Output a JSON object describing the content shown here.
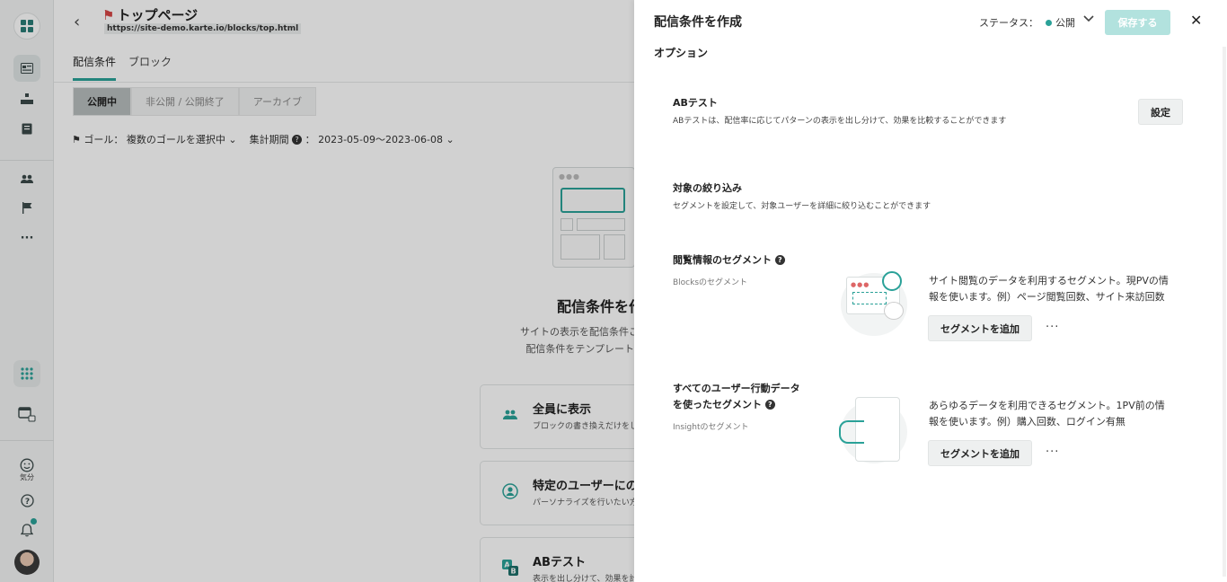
{
  "rail": {
    "mood_label": "気分"
  },
  "page": {
    "title": "トップページ",
    "url": "https://site-demo.karte.io/blocks/top.html",
    "tabs": [
      "配信条件",
      "ブロック"
    ],
    "status_tabs": [
      "公開中",
      "非公開 / 公開終了",
      "アーカイブ"
    ],
    "goal_label": "ゴール：",
    "goal_value": "複数のゴールを選択中",
    "period_label": "集計期間",
    "period_sep": "：",
    "period_value": "2023-05-09〜2023-06-08",
    "empty_title": "配信条件を作",
    "empty_desc_1": "サイトの表示を配信条件こ",
    "empty_desc_2": "配信条件をテンプレート",
    "cards": [
      {
        "title": "全員に表示",
        "desc": "ブロックの書き換えだけをし"
      },
      {
        "title": "特定のユーザーにの",
        "desc": "パーソナライズを行いたい方"
      },
      {
        "title": "ABテスト",
        "desc": "表示を出し分けて、効果を計"
      }
    ]
  },
  "panel": {
    "title": "配信条件を作成",
    "status_label": "ステータス：",
    "status_value": "公開",
    "save_label": "保存する",
    "options_title": "オプション",
    "ab": {
      "title": "ABテスト",
      "desc": "ABテストは、配信率に応じてパターンの表示を出し分けて、効果を比較することができます",
      "button": "設定"
    },
    "target": {
      "title": "対象の絞り込み",
      "desc": "セグメントを設定して、対象ユーザーを詳細に絞り込むことができます"
    },
    "browse_seg": {
      "title": "閲覧情報のセグメント",
      "sub": "Blocksのセグメント",
      "text": "サイト閲覧のデータを利用するセグメント。現PVの情報を使います。例）ページ閲覧回数、サイト来訪回数",
      "button": "セグメントを追加",
      "more": "···"
    },
    "all_seg": {
      "title_1": "すべてのユーザー行動データ",
      "title_2": "を使ったセグメント",
      "sub": "Insightのセグメント",
      "text": "あらゆるデータを利用できるセグメント。1PV前の情報を使います。例）購入回数、ログイン有無",
      "button": "セグメントを追加",
      "more": "···"
    }
  }
}
